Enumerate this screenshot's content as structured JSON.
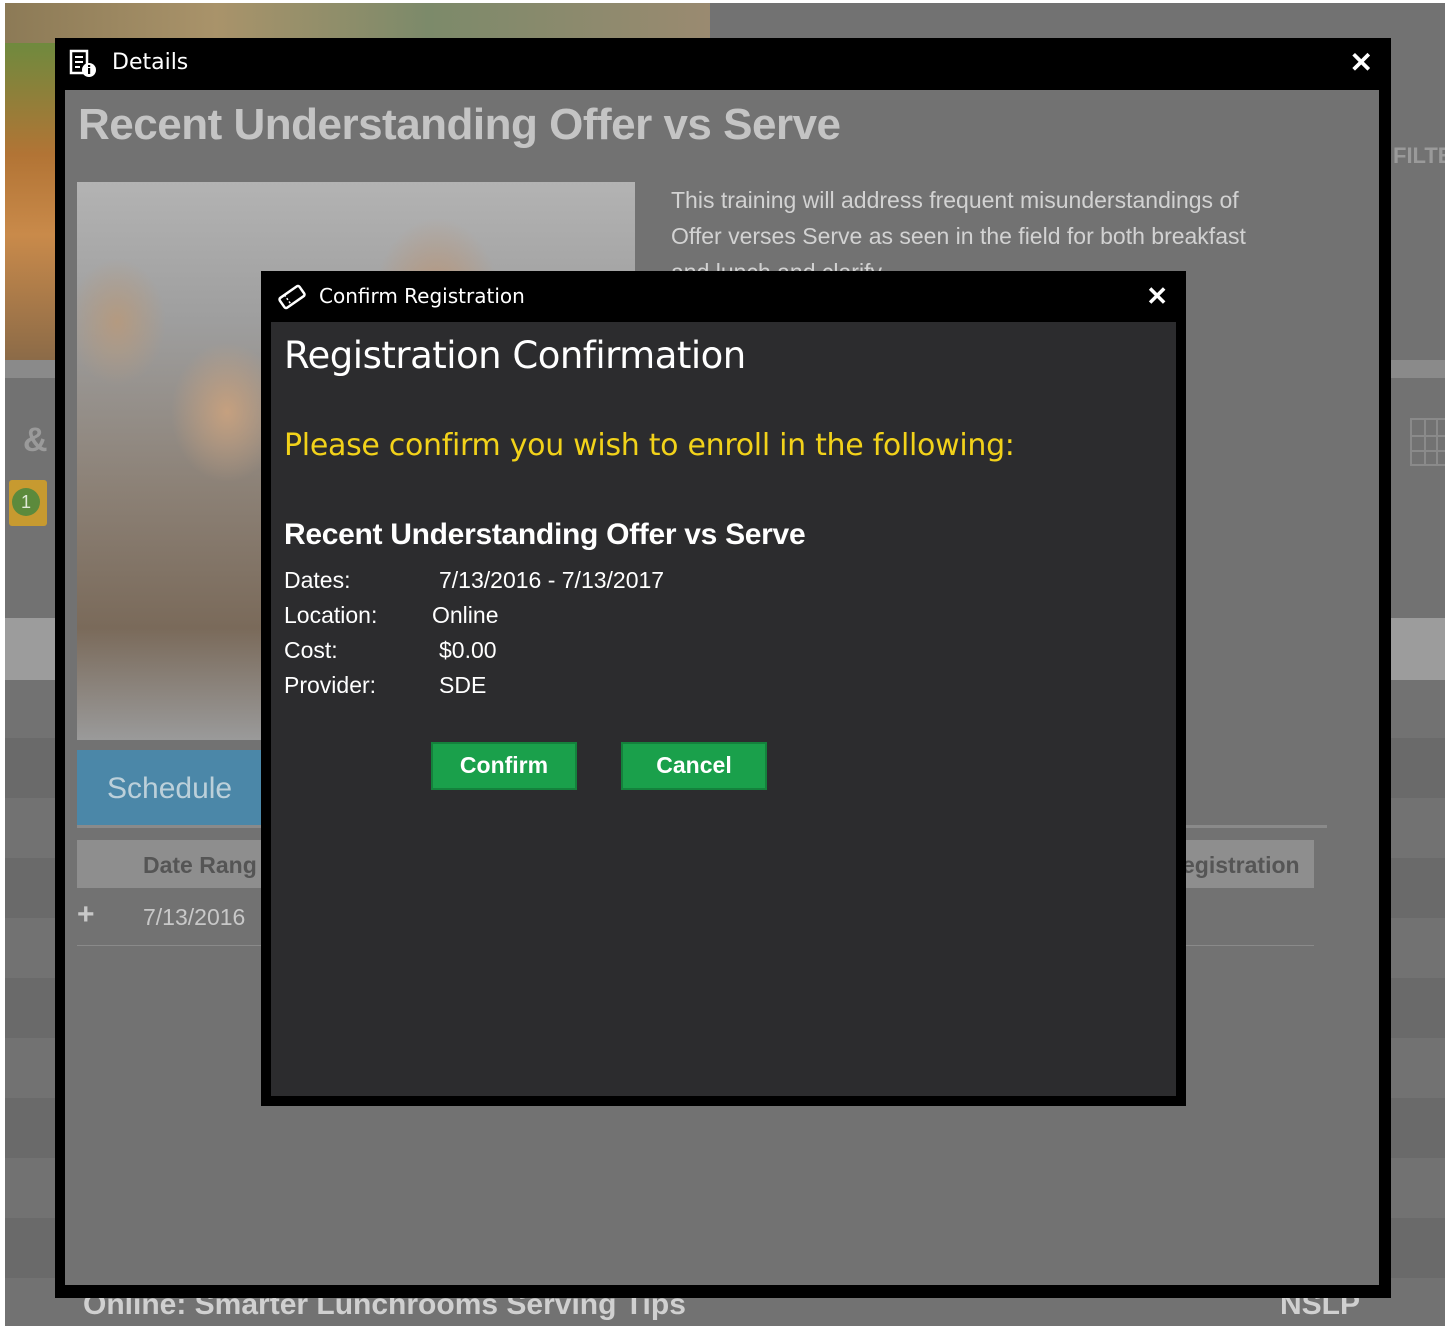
{
  "background": {
    "filter_label": "FILTE",
    "bottom_left_text": "Online: Smarter Lunchrooms Serving Tips",
    "bottom_right_text": "NSLP",
    "badge_count": "1",
    "amp_icon": "ampersand-icon",
    "grid_icon": "grid-view-icon"
  },
  "details": {
    "title": "Details",
    "title_icon": "details-document-icon",
    "close_label": "✕",
    "heading": "Recent Understanding Offer vs Serve",
    "description": "This training will address frequent misunderstandings of Offer verses Serve as seen in the field for both breakfast and lunch and clarify",
    "schedule_tab": "Schedule",
    "table": {
      "col_date": "Date Rang",
      "col_registration": "egistration",
      "rows": [
        {
          "expand": "+",
          "date": "7/13/2016"
        }
      ]
    }
  },
  "modal": {
    "title": "Confirm Registration",
    "title_icon": "ticket-icon",
    "close_label": "✕",
    "heading": "Registration Confirmation",
    "prompt": "Please confirm you wish to enroll in the following:",
    "course_name": "Recent Understanding Offer vs Serve",
    "fields": {
      "dates_label": "Dates:",
      "dates_value": "7/13/2016 - 7/13/2017",
      "location_label": "Location:",
      "location_value": "Online",
      "cost_label": "Cost:",
      "cost_value": "$0.00",
      "provider_label": "Provider:",
      "provider_value": "SDE"
    },
    "confirm_label": "Confirm",
    "cancel_label": "Cancel"
  },
  "colors": {
    "prompt": "#f2d21a",
    "button": "#1aa04b",
    "modal_body": "#2c2c2e",
    "overlay": "#727272"
  }
}
